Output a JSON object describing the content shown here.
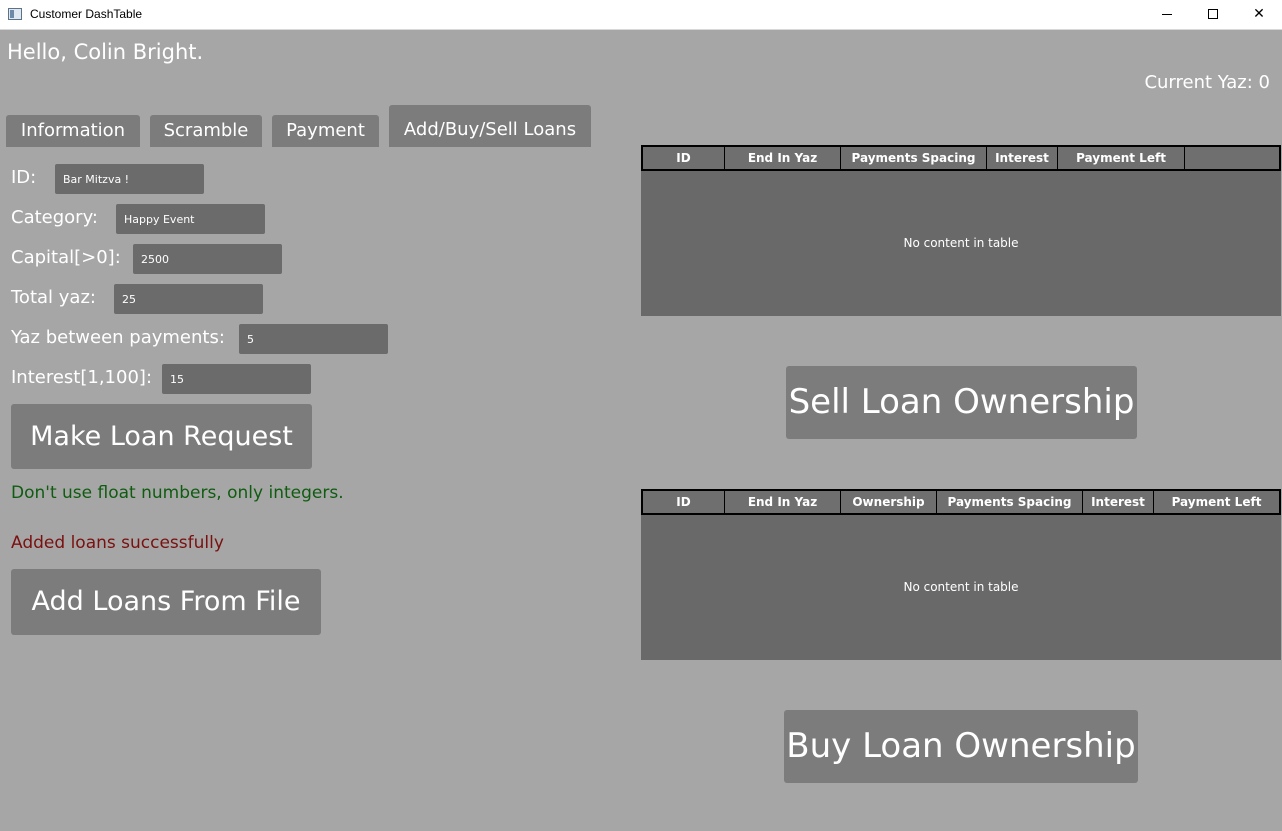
{
  "window": {
    "title": "Customer DashTable",
    "close_glyph": "✕"
  },
  "header": {
    "greeting": "Hello, Colin Bright.",
    "current_yaz": "Current Yaz: 0"
  },
  "tabs": [
    {
      "label": "Information"
    },
    {
      "label": "Scramble"
    },
    {
      "label": "Payment"
    },
    {
      "label": "Add/Buy/Sell Loans",
      "selected": true
    }
  ],
  "form": {
    "id_label": "ID:",
    "id_value": "Bar Mitzva !",
    "category_label": "Category:",
    "category_value": "Happy Event",
    "capital_label": "Capital[>0]:",
    "capital_value": "2500",
    "total_yaz_label": "Total yaz:",
    "total_yaz_value": "25",
    "yaz_between_label": "Yaz between payments:",
    "yaz_between_value": "5",
    "interest_label": "Interest[1,100]:",
    "interest_value": "15",
    "make_request_label": "Make Loan Request",
    "hint": "Don't use float numbers, only integers.",
    "status": "Added loans successfully",
    "add_from_file_label": "Add Loans From File"
  },
  "sell_table": {
    "columns": [
      "ID",
      "End In Yaz",
      "Payments Spacing",
      "Interest",
      "Payment Left"
    ],
    "empty_message": "No content in table"
  },
  "sell_button_label": "Sell Loan Ownership",
  "buy_table": {
    "columns": [
      "ID",
      "End In Yaz",
      "Ownership",
      "Payments Spacing",
      "Interest",
      "Payment Left"
    ],
    "empty_message": "No content in table"
  },
  "buy_button_label": "Buy Loan Ownership",
  "colors": {
    "background": "#a6a6a6",
    "control": "#7c7c7c",
    "input": "#6b6b6b",
    "table": "#696969",
    "hint_text": "#0f5c10",
    "status_text": "#7a1010"
  }
}
